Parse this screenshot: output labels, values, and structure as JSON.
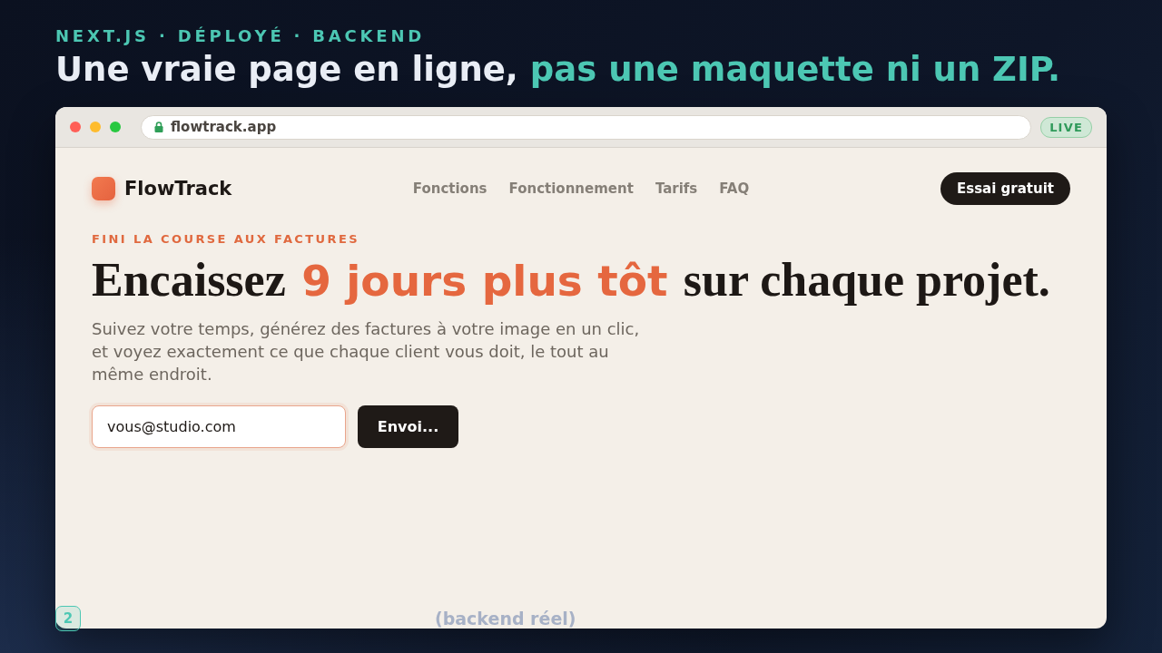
{
  "header": {
    "eyebrow": "NEXT.JS · DÉPLOYÉ · BACKEND",
    "title": [
      {
        "text": "Une vraie page en ligne,",
        "kind": "plain"
      },
      {
        "text": "pas une maquette ni un ZIP.",
        "kind": "accent"
      }
    ]
  },
  "browser": {
    "url": "flowtrack.app",
    "badge": "LIVE",
    "page": {
      "brand": "FlowTrack",
      "nav": [
        "Fonctions",
        "Fonctionnement",
        "Tarifs",
        "FAQ"
      ],
      "cta": "Essai gratuit",
      "eyebrow": "FINI LA COURSE AUX FACTURES",
      "headline": [
        {
          "text": "Encaissez",
          "kind": "serif"
        },
        {
          "text": "9 jours plus tôt",
          "kind": "accent"
        },
        {
          "text": "sur chaque projet.",
          "kind": "serif"
        }
      ],
      "lead": "Suivez votre temps, générez des factures à votre image en un clic, et voyez exactement ce que chaque client vous doit, le tout au même endroit.",
      "form": {
        "email": {
          "value": "vous@studio.com"
        },
        "submit": "Envoi..."
      }
    }
  },
  "caption": {
    "number": "2",
    "text": "(backend réel)"
  }
}
